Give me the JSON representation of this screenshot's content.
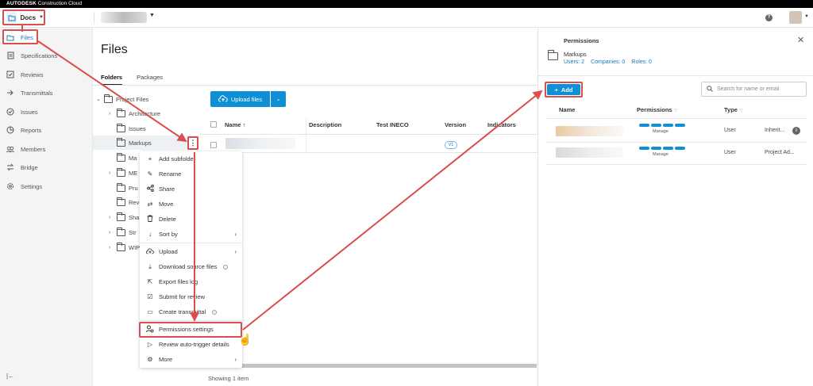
{
  "brand": {
    "name": "AUTODESK",
    "product": "Construction Cloud"
  },
  "header": {
    "module_label": "Docs"
  },
  "sidebar": {
    "items": [
      {
        "label": "Files",
        "icon": "folder-icon"
      },
      {
        "label": "Specifications",
        "icon": "spec-icon"
      },
      {
        "label": "Reviews",
        "icon": "review-icon"
      },
      {
        "label": "Transmittals",
        "icon": "transmittal-icon"
      },
      {
        "label": "Issues",
        "icon": "issue-icon"
      },
      {
        "label": "Reports",
        "icon": "report-icon"
      },
      {
        "label": "Members",
        "icon": "members-icon"
      },
      {
        "label": "Bridge",
        "icon": "bridge-icon"
      },
      {
        "label": "Settings",
        "icon": "gear-icon"
      }
    ]
  },
  "main": {
    "title": "Files",
    "tabs": [
      {
        "label": "Folders"
      },
      {
        "label": "Packages"
      }
    ],
    "tree": [
      {
        "label": "Project Files"
      },
      {
        "label": "Architecture"
      },
      {
        "label": "Issues"
      },
      {
        "label": "Markups"
      },
      {
        "label": "Ma"
      },
      {
        "label": "ME"
      },
      {
        "label": "Pru"
      },
      {
        "label": "Rev"
      },
      {
        "label": "Sha"
      },
      {
        "label": "Str"
      },
      {
        "label": "WIP"
      }
    ],
    "upload_label": "Upload files",
    "columns": [
      "Name",
      "Description",
      "Test INECO",
      "Version",
      "Indicators"
    ],
    "row": {
      "version": "V1"
    },
    "footer": "Showing 1 item"
  },
  "context_menu": {
    "items": [
      {
        "label": "Add subfolder"
      },
      {
        "label": "Rename"
      },
      {
        "label": "Share"
      },
      {
        "label": "Move"
      },
      {
        "label": "Delete"
      },
      {
        "label": "Sort by"
      },
      {
        "label": "Upload"
      },
      {
        "label": "Download source files"
      },
      {
        "label": "Export files log"
      },
      {
        "label": "Submit for review"
      },
      {
        "label": "Create transmittal"
      },
      {
        "label": "Permissions settings"
      },
      {
        "label": "Review auto-trigger details"
      },
      {
        "label": "More"
      }
    ]
  },
  "panel": {
    "title": "Permissions",
    "folder": "Markups",
    "stats": [
      "Users: 2",
      "Companies: 0",
      "Roles: 0"
    ],
    "add_label": "Add",
    "search_placeholder": "Search for name or email",
    "columns": [
      "Name",
      "Permissions",
      "Type"
    ],
    "rows": [
      {
        "permission": "Manage",
        "type": "User",
        "source": "Inherit..."
      },
      {
        "permission": "Manage",
        "type": "User",
        "source": "Project Ad..."
      }
    ]
  },
  "colors": {
    "accent": "#0e8fd6",
    "highlight": "#d94e4e"
  }
}
